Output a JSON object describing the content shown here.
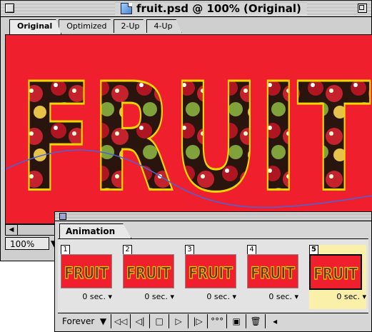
{
  "window": {
    "title": "fruit.psd @ 100% (Original)",
    "tabs": [
      "Original",
      "Optimized",
      "2-Up",
      "4-Up"
    ],
    "zoom": "100%"
  },
  "artwork": {
    "text": "FRUIT"
  },
  "animation": {
    "tab": "Animation",
    "frames": [
      {
        "num": "1",
        "duration": "0 sec."
      },
      {
        "num": "2",
        "duration": "0 sec."
      },
      {
        "num": "3",
        "duration": "0 sec."
      },
      {
        "num": "4",
        "duration": "0 sec."
      },
      {
        "num": "5",
        "duration": "0 sec."
      }
    ],
    "loop": "Forever",
    "selected_frame": "5"
  },
  "colors": {
    "canvas_bg": "#f01f2e",
    "letter_outline": "#f4d600",
    "selected_frame": "#fbf0a9"
  }
}
